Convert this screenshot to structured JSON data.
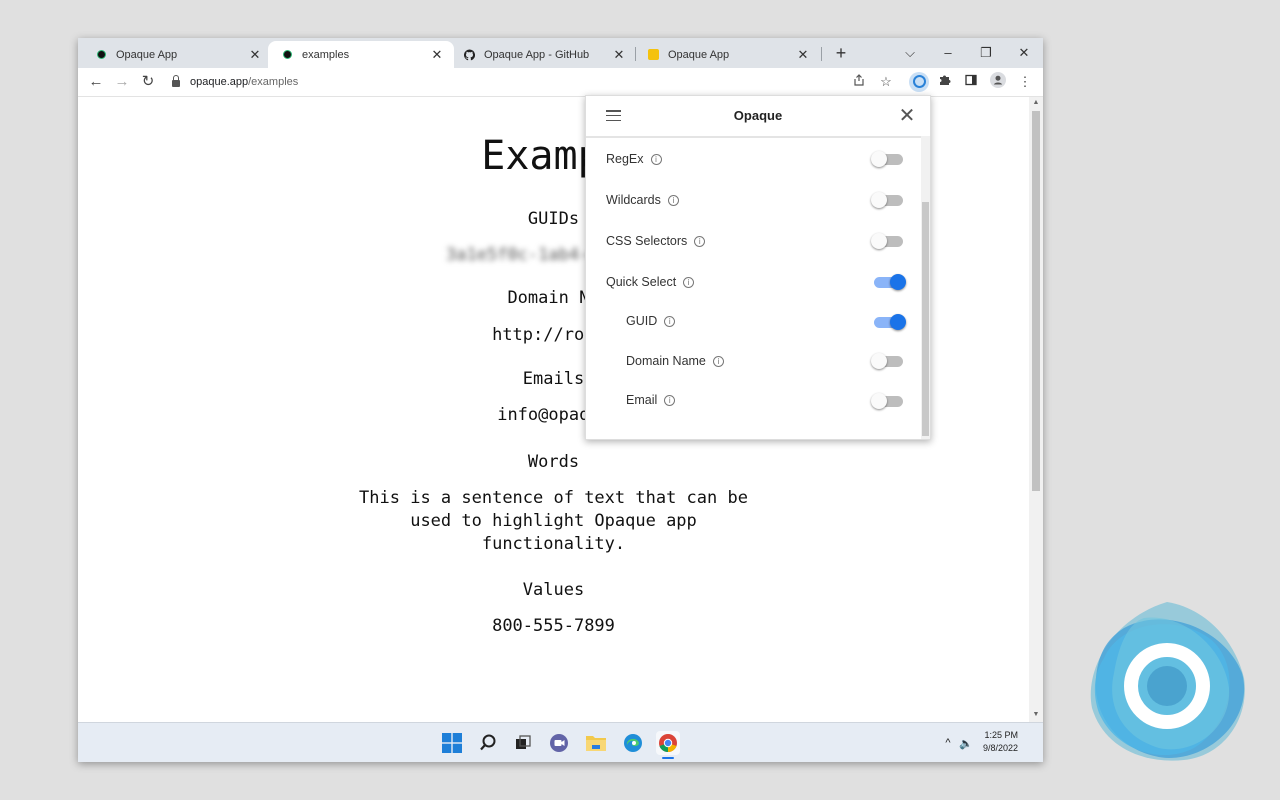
{
  "browser": {
    "tabs": [
      {
        "title": "Opaque App",
        "close": "✕"
      },
      {
        "title": "examples",
        "close": "✕"
      },
      {
        "title": "Opaque App - GitHub",
        "close": "✕"
      },
      {
        "title": "Opaque App",
        "close": "✕"
      }
    ],
    "new_tab": "+",
    "window_controls": {
      "dropdown": "⌵",
      "minimize": "–",
      "restore": "❐",
      "close": "✕"
    },
    "nav": {
      "back": "←",
      "forward": "→",
      "reload": "↻"
    },
    "url_domain": "opaque.app",
    "url_path": "/examples",
    "menu": "⋮"
  },
  "page": {
    "title": "Exampl",
    "guids_heading": "GUIDs",
    "guids_value": "3a1e5f0c-1ab4-4d8c-9e",
    "domain_heading": "Domain Na",
    "domain_value": "http://root.",
    "emails_heading": "Emails",
    "emails_value": "info@opaque",
    "words_heading": "Words",
    "words_line1": "This is a sentence of text that can be",
    "words_line2": "used to highlight Opaque app",
    "words_line3": "functionality.",
    "values_heading": "Values",
    "values_value": "800-555-7899"
  },
  "popup": {
    "title": "Opaque",
    "close": "✕",
    "info_glyph": "i",
    "options": [
      {
        "label": "RegEx",
        "on": false
      },
      {
        "label": "Wildcards",
        "on": false
      },
      {
        "label": "CSS Selectors",
        "on": false
      },
      {
        "label": "Quick Select",
        "on": true
      },
      {
        "label": "GUID",
        "on": true
      },
      {
        "label": "Domain Name",
        "on": false
      },
      {
        "label": "Email",
        "on": false
      }
    ]
  },
  "taskbar": {
    "tray_chevron": "^",
    "volume": "🔈",
    "time": "1:25 PM",
    "date": "9/8/2022"
  },
  "colors": {
    "toggle_on": "#1a73e8",
    "toggle_on_track": "#8ab4f8",
    "toggle_off_track": "#bdbdbd",
    "tabstrip_bg": "#dfe3e8",
    "logo_blue": "#2a82d8"
  }
}
